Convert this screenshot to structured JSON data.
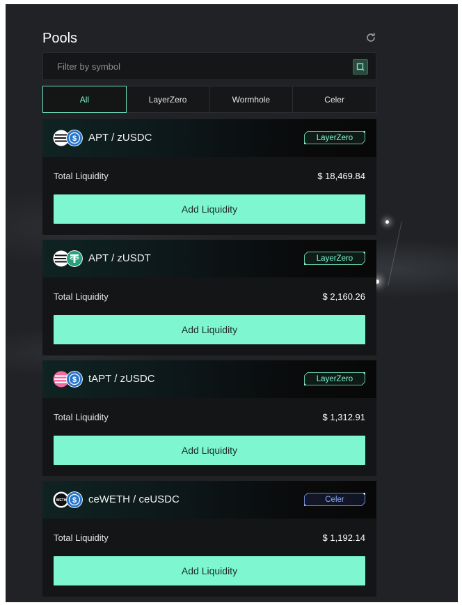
{
  "header": {
    "title": "Pools"
  },
  "search": {
    "placeholder": "Filter by symbol"
  },
  "tabs": [
    {
      "label": "All"
    },
    {
      "label": "LayerZero"
    },
    {
      "label": "Wormhole"
    },
    {
      "label": "Celer"
    }
  ],
  "colors": {
    "accent": "#7ef7d1",
    "layerzero_badge": "#7ef7d1",
    "celer_badge": "#8ba7ff",
    "usdc": "#2775ca",
    "usdt": "#26a17b",
    "tapt": "#f06ba0"
  },
  "pools": [
    {
      "pair": "APT / zUSDC",
      "icons": [
        "apt-token-icon",
        "usdc-token-icon"
      ],
      "bridge": "LayerZero",
      "liquidity_label": "Total Liquidity",
      "liquidity_value": "$ 18,469.84",
      "action": "Add Liquidity"
    },
    {
      "pair": "APT / zUSDT",
      "icons": [
        "apt-token-icon",
        "usdt-token-icon"
      ],
      "bridge": "LayerZero",
      "liquidity_label": "Total Liquidity",
      "liquidity_value": "$ 2,160.26",
      "action": "Add Liquidity"
    },
    {
      "pair": "tAPT / zUSDC",
      "icons": [
        "tapt-token-icon",
        "usdc-token-icon"
      ],
      "bridge": "LayerZero",
      "liquidity_label": "Total Liquidity",
      "liquidity_value": "$ 1,312.91",
      "action": "Add Liquidity"
    },
    {
      "pair": "ceWETH / ceUSDC",
      "icons": [
        "weth-token-icon",
        "usdc-token-icon"
      ],
      "weth_label": "WETH",
      "bridge": "Celer",
      "liquidity_label": "Total Liquidity",
      "liquidity_value": "$ 1,192.14",
      "action": "Add Liquidity"
    }
  ]
}
